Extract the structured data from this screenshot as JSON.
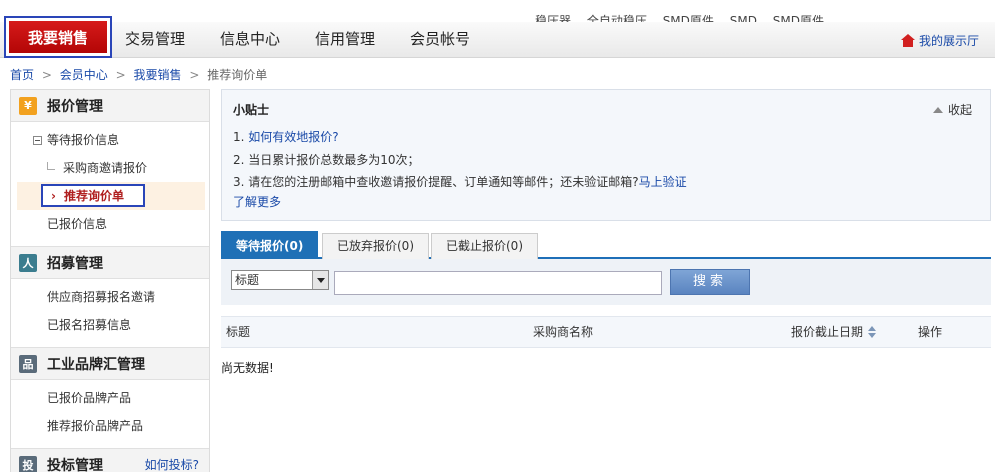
{
  "top_links": [
    "稳压器",
    "全自动稳压",
    "SMD原件",
    "SMD",
    "SMD原件"
  ],
  "nav": {
    "active": "我要销售",
    "items": [
      "交易管理",
      "信息中心",
      "信用管理",
      "会员帐号"
    ],
    "showroom": "我的展示厅"
  },
  "breadcrumb": {
    "items": [
      "首页",
      "会员中心",
      "我要销售"
    ],
    "current": "推荐询价单",
    "separator": ">"
  },
  "sidebar": {
    "quote": {
      "title": "报价管理",
      "icon_glyph": "¥",
      "pending": "等待报价信息",
      "invited": "采购商邀请报价",
      "recommended": "推荐询价单",
      "quoted": "已报价信息"
    },
    "recruit": {
      "title": "招募管理",
      "icon_glyph": "人",
      "invites": "供应商招募报名邀请",
      "signed": "已报名招募信息"
    },
    "brand": {
      "title": "工业品牌汇管理",
      "icon_glyph": "品",
      "quoted_products": "已报价品牌产品",
      "recommended_products": "推荐报价品牌产品"
    },
    "bid": {
      "title": "投标管理",
      "icon_glyph": "投",
      "help": "如何投标?"
    }
  },
  "tips": {
    "title": "小贴士",
    "collapse": "收起",
    "line1_prefix": "1. ",
    "line1_link": "如何有效地报价?",
    "line2": "2. 当日累计报价总数最多为10次；",
    "line3_text": "3. 请在您的注册邮箱中查收邀请报价提醒、订单通知等邮件；还未验证邮箱?",
    "line3_link": "马上验证",
    "more": "了解更多"
  },
  "tabs": [
    {
      "label": "等待报价(0)",
      "active": true
    },
    {
      "label": "已放弃报价(0)",
      "active": false
    },
    {
      "label": "已截止报价(0)",
      "active": false
    }
  ],
  "search": {
    "select_value": "标题",
    "input_value": "",
    "button": "搜索"
  },
  "table": {
    "headers": [
      "标题",
      "采购商名称",
      "报价截止日期",
      "操作"
    ],
    "empty": "尚无数据!"
  },
  "colors": {
    "brand_red": "#c40f0f",
    "highlight_blue": "#2a45b8",
    "tab_blue": "#1f70b6",
    "link_blue": "#1a4aa8"
  }
}
